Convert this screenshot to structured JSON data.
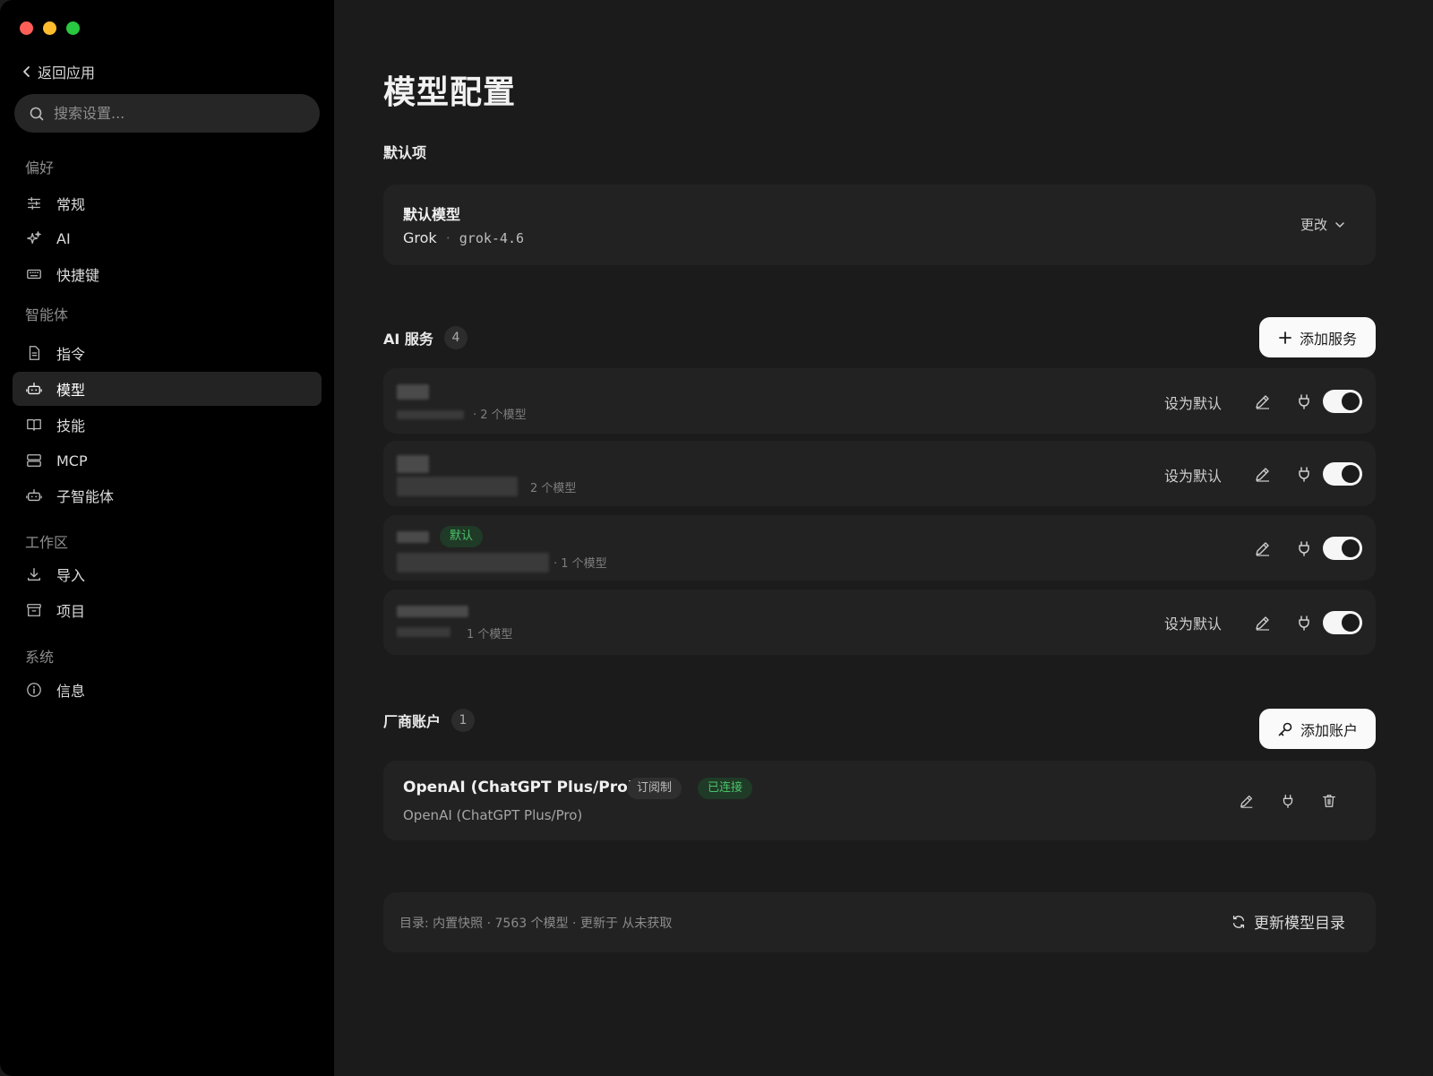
{
  "sidebar": {
    "back_label": "返回应用",
    "search_placeholder": "搜索设置...",
    "sections": [
      {
        "title": "偏好",
        "items": [
          {
            "label": "常规",
            "icon": "sliders-icon"
          },
          {
            "label": "AI",
            "icon": "sparkles-icon"
          },
          {
            "label": "快捷键",
            "icon": "keyboard-icon"
          }
        ]
      },
      {
        "title": "智能体",
        "items": [
          {
            "label": "指令",
            "icon": "document-icon"
          },
          {
            "label": "模型",
            "icon": "bot-icon",
            "active": true
          },
          {
            "label": "技能",
            "icon": "book-icon"
          },
          {
            "label": "MCP",
            "icon": "server-icon"
          },
          {
            "label": "子智能体",
            "icon": "bot-icon"
          }
        ]
      },
      {
        "title": "工作区",
        "items": [
          {
            "label": "导入",
            "icon": "download-icon"
          },
          {
            "label": "项目",
            "icon": "archive-icon"
          }
        ]
      },
      {
        "title": "系统",
        "items": [
          {
            "label": "信息",
            "icon": "info-icon"
          }
        ]
      }
    ]
  },
  "main": {
    "title": "模型配置",
    "defaults": {
      "heading": "默认项",
      "card_label": "默认模型",
      "provider": "Grok",
      "separator": "·",
      "model": "grok-4.6",
      "change_label": "更改"
    },
    "services": {
      "heading": "AI 服务",
      "count": "4",
      "add_label": "添加服务",
      "set_default_label": "设为默认",
      "default_badge": "默认",
      "rows": [
        {
          "models": "· 2 个模型",
          "is_default": false,
          "enabled": true
        },
        {
          "models": "2 个模型",
          "is_default": false,
          "enabled": true
        },
        {
          "models": "· 1 个模型",
          "is_default": true,
          "enabled": true
        },
        {
          "models": "1 个模型",
          "is_default": false,
          "enabled": true
        }
      ]
    },
    "accounts": {
      "heading": "厂商账户",
      "count": "1",
      "add_label": "添加账户",
      "items": [
        {
          "title": "OpenAI (ChatGPT Plus/Pro)",
          "subtitle": "OpenAI (ChatGPT Plus/Pro)",
          "badge_type": "订阅制",
          "badge_status": "已连接"
        }
      ]
    },
    "catalog": {
      "text": "目录: 内置快照 · 7563 个模型 · 更新于 从未获取",
      "refresh_label": "更新模型目录"
    }
  }
}
